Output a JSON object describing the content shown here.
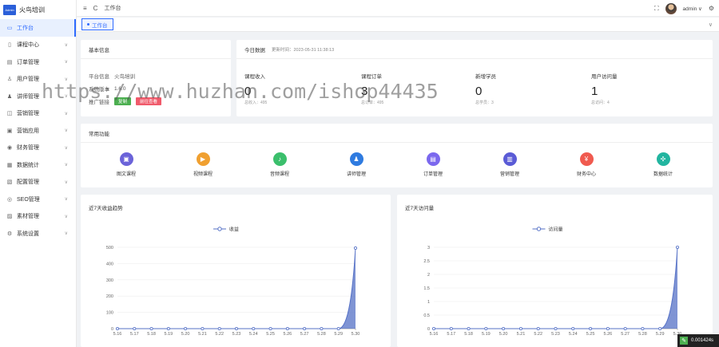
{
  "app": {
    "logo_badge": "Admin",
    "title": "火鸟培训"
  },
  "sidebar": {
    "items": [
      {
        "label": "工作台",
        "icon": "monitor-icon",
        "active": true
      },
      {
        "label": "课程中心",
        "icon": "book-icon"
      },
      {
        "label": "订单管理",
        "icon": "order-icon"
      },
      {
        "label": "用户管理",
        "icon": "user-icon"
      },
      {
        "label": "讲师管理",
        "icon": "teacher-icon"
      },
      {
        "label": "营销管理",
        "icon": "marketing-icon"
      },
      {
        "label": "营销应用",
        "icon": "app-icon"
      },
      {
        "label": "财务管理",
        "icon": "finance-icon"
      },
      {
        "label": "数据统计",
        "icon": "data-icon"
      },
      {
        "label": "配置管理",
        "icon": "config-icon"
      },
      {
        "label": "SEO管理",
        "icon": "seo-icon"
      },
      {
        "label": "素材管理",
        "icon": "material-icon"
      },
      {
        "label": "系统设置",
        "icon": "settings-icon"
      }
    ]
  },
  "topbar": {
    "menu_icon": "≡",
    "refresh_icon": "C",
    "title": "工作台",
    "fullscreen_icon": "⛶",
    "user": "admin ∨",
    "settings_icon": "⚙"
  },
  "tabs": [
    {
      "label": "工作台"
    }
  ],
  "basic_info": {
    "title": "基本信息",
    "platform_label": "平台信息",
    "platform_value": "火鸟培训",
    "version_label": "系统版本",
    "version_value": "1.6.0",
    "promo_label": "推广链接",
    "btn_copy": "复制",
    "btn_view": "前往查看"
  },
  "today": {
    "title": "今日数据",
    "update_time": "更新时间：2023-05-31 11:38:13",
    "stats": [
      {
        "label": "课程收入",
        "value": "0",
        "sub": "总收入：495"
      },
      {
        "label": "课程订单",
        "value": "3",
        "sub": "总订单：495"
      },
      {
        "label": "新增学员",
        "value": "0",
        "sub": "总学员：3"
      },
      {
        "label": "用户访问量",
        "value": "1",
        "sub": "总访问：4"
      }
    ]
  },
  "shortcuts": {
    "title": "常用功能",
    "items": [
      {
        "label": "图文课程",
        "icon": "image-icon",
        "color": "#6b63d9"
      },
      {
        "label": "视频课程",
        "icon": "video-icon",
        "color": "#f0a030"
      },
      {
        "label": "音频课程",
        "icon": "audio-icon",
        "color": "#3bbf6c"
      },
      {
        "label": "讲师管理",
        "icon": "teacher-icon",
        "color": "#2f7be0"
      },
      {
        "label": "订单管理",
        "icon": "order-icon",
        "color": "#7b68ee"
      },
      {
        "label": "营销管理",
        "icon": "marketing-icon",
        "color": "#5a5bd6"
      },
      {
        "label": "财务中心",
        "icon": "finance-icon",
        "color": "#f05a4f"
      },
      {
        "label": "数据统计",
        "icon": "data-icon",
        "color": "#22b5a0"
      }
    ]
  },
  "chart_data": [
    {
      "type": "area",
      "title": "近7天收益趋势",
      "legend": "收益",
      "categories": [
        "5.16",
        "5.17",
        "5.18",
        "5.19",
        "5.20",
        "5.21",
        "5.22",
        "5.23",
        "5.24",
        "5.25",
        "5.26",
        "5.27",
        "5.28",
        "5.29",
        "5.30"
      ],
      "values": [
        0,
        0,
        0,
        0,
        0,
        0,
        0,
        0,
        0,
        0,
        0,
        0,
        0,
        0,
        495
      ],
      "ylim": [
        0,
        500
      ],
      "yticks": [
        "0",
        "100",
        "200",
        "300",
        "400",
        "500"
      ],
      "color": "#5470c6"
    },
    {
      "type": "area",
      "title": "近7天访问量",
      "legend": "访问量",
      "categories": [
        "5.16",
        "5.17",
        "5.18",
        "5.19",
        "5.20",
        "5.21",
        "5.22",
        "5.23",
        "5.24",
        "5.25",
        "5.26",
        "5.27",
        "5.28",
        "5.29",
        "5.30"
      ],
      "values": [
        0,
        0,
        0,
        0,
        0,
        0,
        0,
        0,
        0,
        0,
        0,
        0,
        0,
        0,
        3
      ],
      "ylim": [
        0,
        3
      ],
      "yticks": [
        "0",
        "0.5",
        "1",
        "1.5",
        "2",
        "2.5",
        "3"
      ],
      "color": "#5470c6"
    }
  ],
  "watermark": "https://www.huzhan.com/ishop44435",
  "corner": {
    "text": "0.001424s"
  }
}
